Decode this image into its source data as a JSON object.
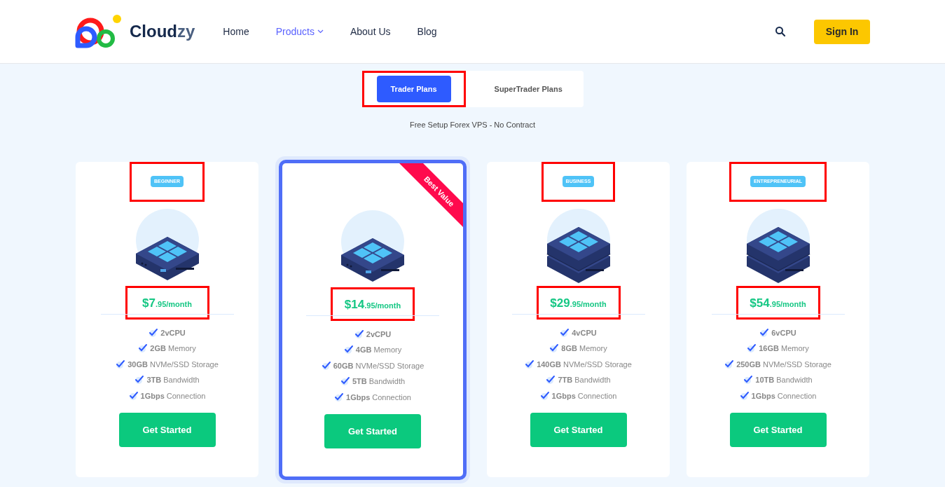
{
  "header": {
    "logo_text": "Cloud",
    "logo_accent": "zy",
    "nav": [
      {
        "label": "Home",
        "selected": false,
        "dropdown": false
      },
      {
        "label": "Products",
        "selected": true,
        "dropdown": true
      },
      {
        "label": "About Us",
        "selected": false,
        "dropdown": false
      },
      {
        "label": "Blog",
        "selected": false,
        "dropdown": false
      }
    ],
    "sign_in": "Sign In"
  },
  "plan_tabs": [
    {
      "label": "Trader Plans",
      "selected": true,
      "highlighted": true
    },
    {
      "label": "SuperTrader Plans",
      "selected": false,
      "highlighted": false
    }
  ],
  "subtitle": "Free Setup Forex VPS - No Contract",
  "plans": [
    {
      "badge": "BEGINNER",
      "badge_highlighted": true,
      "kind": "single",
      "featured": false,
      "amount": "$7",
      "fraction": ".95",
      "period": "/month",
      "price_highlighted": true,
      "features": [
        "**2vCPU**",
        "**2GB** Memory",
        "**30GB** NVMe/SSD Storage",
        "**3TB** Bandwidth",
        "**1Gbps** Connection"
      ],
      "button": "Get Started"
    },
    {
      "badge_highlighted": false,
      "kind": "single",
      "featured": true,
      "ribbon": "Best Value",
      "amount": "$14",
      "fraction": ".95",
      "period": "/month",
      "price_highlighted": true,
      "features": [
        "**2vCPU**",
        "**4GB** Memory",
        "**60GB** NVMe/SSD Storage",
        "**5TB** Bandwidth",
        "**1Gbps** Connection"
      ],
      "button": "Get Started"
    },
    {
      "badge": "BUSINESS",
      "badge_highlighted": true,
      "kind": "double",
      "featured": false,
      "amount": "$29",
      "fraction": ".95",
      "period": "/month",
      "price_highlighted": true,
      "features": [
        "**4vCPU**",
        "**8GB** Memory",
        "**140GB** NVMe/SSD Storage",
        "**7TB** Bandwidth",
        "**1Gbps** Connection"
      ],
      "button": "Get Started"
    },
    {
      "badge": "ENTREPRENEURIAL",
      "badge_highlighted": true,
      "kind": "double",
      "featured": false,
      "amount": "$54",
      "fraction": ".95",
      "period": "/month",
      "price_highlighted": true,
      "features": [
        "**6vCPU**",
        "**16GB** Memory",
        "**250GB** NVMe/SSD Storage",
        "**10TB** Bandwidth",
        "**1Gbps** Connection"
      ],
      "button": "Get Started"
    }
  ]
}
